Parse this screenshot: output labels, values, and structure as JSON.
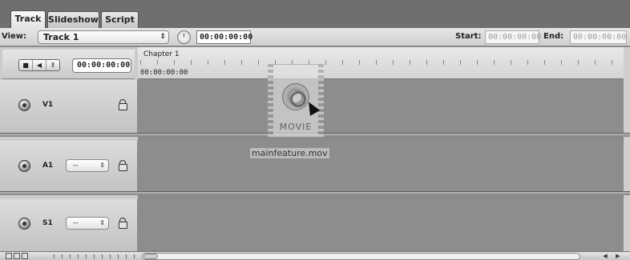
{
  "tabs": [
    {
      "label": "Track",
      "active": true
    },
    {
      "label": "Slideshow",
      "active": false
    },
    {
      "label": "Script",
      "active": false
    }
  ],
  "viewbar": {
    "view_label": "View:",
    "view_value": "Track 1",
    "timecode": "00:00:00:00",
    "start_label": "Start:",
    "start_value": "00:00:00:00",
    "end_label": "End:",
    "end_value": "00:00:00:00"
  },
  "controls": {
    "buttons": [
      "■",
      "◀",
      "⦀"
    ],
    "timecode": "00:00:00:00"
  },
  "ruler": {
    "chapter_label": "Chapter 1",
    "timecode": "00:00:00:00"
  },
  "tracks": [
    {
      "name": "V1",
      "icon": "video-track-icon",
      "has_select": false
    },
    {
      "name": "A1",
      "icon": "audio-track-icon",
      "has_select": true,
      "select_value": "--"
    },
    {
      "name": "S1",
      "icon": "subtitle-track-icon",
      "has_select": true,
      "select_value": "--"
    }
  ],
  "drag_item": {
    "badge": "MOVIE",
    "filename": "mainfeature.mov"
  },
  "colors": {
    "track_area": "#8d8d8d",
    "header_bg": "#cbcbcb",
    "tabbar_bg": "#6f6f6f"
  }
}
